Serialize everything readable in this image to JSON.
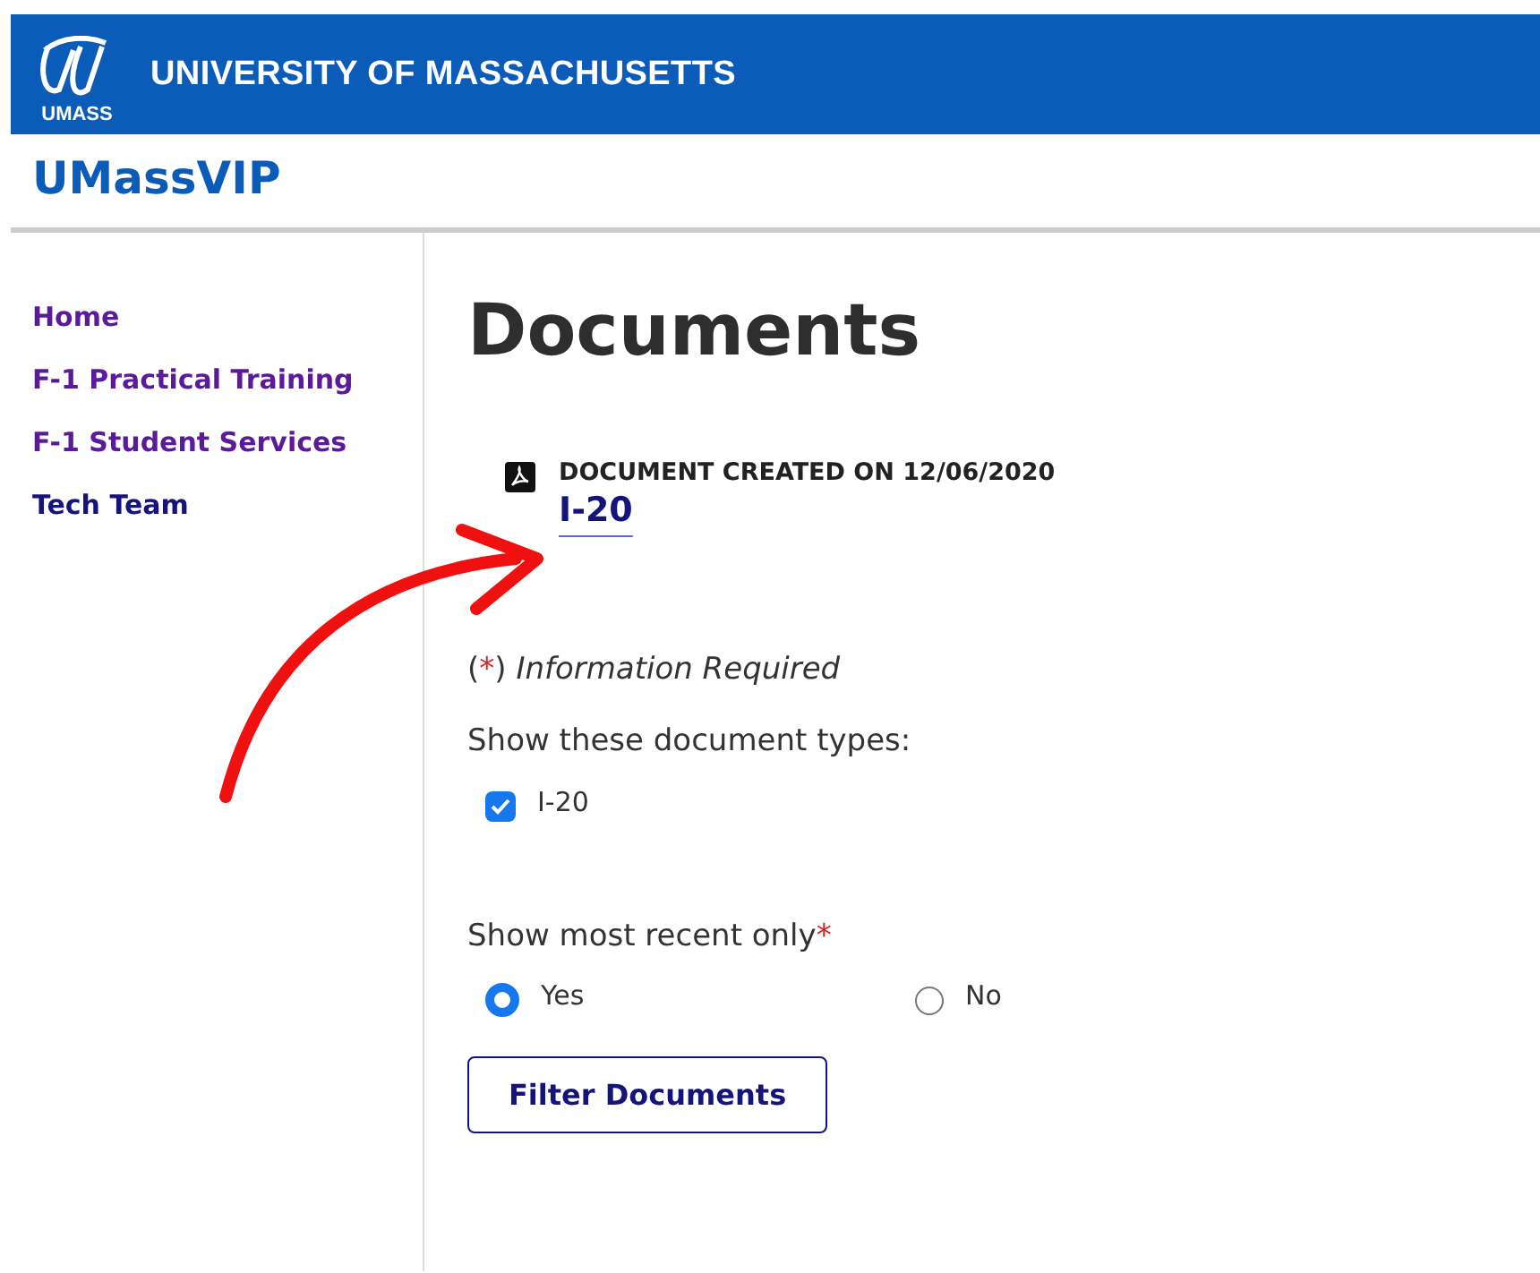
{
  "banner": {
    "logo_text": "UMASS",
    "title": "UNIVERSITY OF MASSACHUSETTS"
  },
  "site_title": "UMassVIP",
  "sidebar": {
    "items": [
      {
        "label": "Home",
        "visited": true
      },
      {
        "label": "F-1 Practical Training",
        "visited": true
      },
      {
        "label": "F-1 Student Services",
        "visited": true
      },
      {
        "label": "Tech Team",
        "visited": false
      }
    ]
  },
  "page_title": "Documents",
  "documents": [
    {
      "created": "DOCUMENT CREATED ON 12/06/2020",
      "link": "I-20"
    }
  ],
  "required_note": {
    "open": "(",
    "marker": "*",
    "close": ")",
    "text": "Information Required"
  },
  "document_types": {
    "label": "Show these document types:",
    "options": [
      {
        "label": "I-20",
        "checked": true
      }
    ]
  },
  "most_recent": {
    "label": "Show most recent only",
    "marker": "*",
    "options": [
      {
        "label": "Yes",
        "selected": true
      },
      {
        "label": "No",
        "selected": false
      }
    ]
  },
  "filter_button": "Filter Documents"
}
